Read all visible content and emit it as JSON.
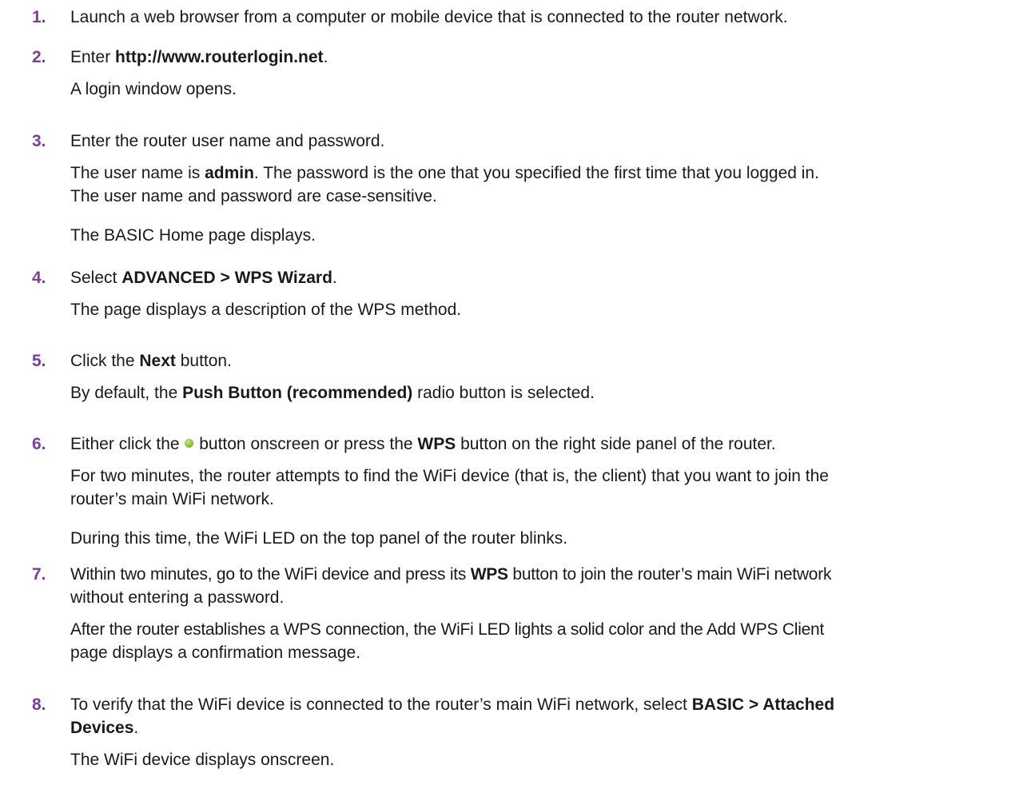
{
  "steps": [
    {
      "num": "1.",
      "text": "Launch a web browser from a computer or mobile device that is connected to the router network."
    },
    {
      "num": "2.",
      "pre": "Enter ",
      "bold": "http://www.routerlogin.net",
      "post": ".",
      "result": "A login window opens."
    },
    {
      "num": "3.",
      "text": "Enter the router user name and password.",
      "r1_pre": "The user name is ",
      "r1_bold": "admin",
      "r1_post": ". The password is the one that you specified the first time that you logged in.",
      "r1_line2": "The user name and password are case-sensitive.",
      "r2": "The BASIC Home page displays."
    },
    {
      "num": "4.",
      "pre": "Select ",
      "bold": "ADVANCED > WPS Wizard",
      "post": ".",
      "result": "The page displays a description of the WPS method."
    },
    {
      "num": "5.",
      "pre": "Click the ",
      "bold": "Next",
      "post": " button.",
      "r_pre": "By default, the ",
      "r_bold": "Push Button (recommended)",
      "r_post": " radio button is selected."
    },
    {
      "num": "6.",
      "pre": "Either click the ",
      "mid": " button onscreen or press the ",
      "bold": "WPS",
      "post": " button on the right side panel of the router.",
      "r1_line1": "For two minutes, the router attempts to find the WiFi device (that is, the client) that you want to join the",
      "r1_line2": "router’s main WiFi network.",
      "r2": "During this time, the WiFi LED on the top panel of the router blinks."
    },
    {
      "num": "7.",
      "pre": "Within two minutes, go to the WiFi device and press its ",
      "bold": "WPS",
      "post": " button to join the router’s main WiFi network",
      "line2": "without entering a password.",
      "r1_line1": "After the router establishes a WPS connection, the WiFi LED lights a solid color and the Add WPS Client",
      "r1_line2": "page displays a confirmation message."
    },
    {
      "num": "8.",
      "pre": "To verify that the WiFi device is connected to the router’s main WiFi network, select ",
      "bold1": "BASIC > Attached",
      "bold2": "Devices",
      "post": ".",
      "result": "The WiFi device displays onscreen."
    }
  ],
  "icons": {
    "wps_button": "wps-push-button-icon",
    "wps_color": "#8cbf3a"
  },
  "colors": {
    "step_number": "#7b3f98",
    "text": "#1a1a1a"
  }
}
